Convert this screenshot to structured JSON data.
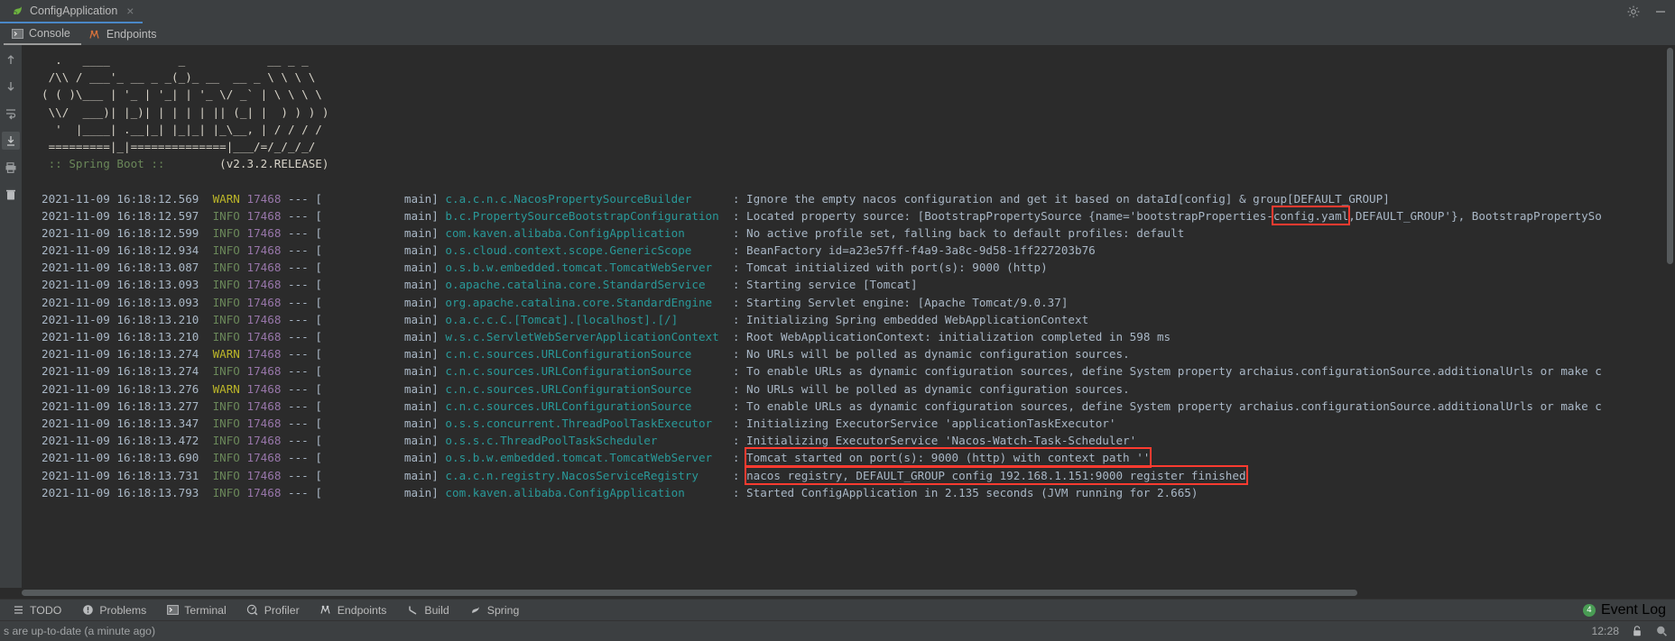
{
  "titlebar": {
    "run_tab_label": "ConfigApplication",
    "close_label": "×",
    "settings_icon": "gear-icon",
    "minimize_icon": "minimize-icon"
  },
  "tool_tabs": [
    {
      "label": "Console",
      "icon": "console-icon",
      "active": true
    },
    {
      "label": "Endpoints",
      "icon": "endpoints-icon",
      "active": false
    }
  ],
  "gutter_buttons": [
    {
      "name": "scroll-up-icon"
    },
    {
      "name": "scroll-down-icon"
    },
    {
      "name": "soft-wrap-icon"
    },
    {
      "name": "scroll-to-end-icon"
    },
    {
      "name": "print-icon"
    },
    {
      "name": "clear-all-icon"
    }
  ],
  "console": {
    "banner_lines": [
      "  .   ____          _            __ _ _",
      " /\\\\ / ___'_ __ _ _(_)_ __  __ _ \\ \\ \\ \\",
      "( ( )\\___ | '_ | '_| | '_ \\/ _` | \\ \\ \\ \\",
      " \\\\/  ___)| |_)| | | | | || (_| |  ) ) ) )",
      "  '  |____| .__|_| |_|_| |_\\__, | / / / /",
      " =========|_|==============|___/=/_/_/_/"
    ],
    "banner_title": " :: Spring Boot :: ",
    "banner_version": "       (v2.3.2.RELEASE)",
    "lines": [
      {
        "ts": "2021-11-09 16:18:12.569",
        "level": "WARN",
        "pid": "17468",
        "sep": "--- [",
        "thread": "            main]",
        "logger": "c.a.c.n.c.NacosPropertySourceBuilder",
        "pad": "     ",
        "msg_pre": ": Ignore the empty nacos configuration and get it based on dataId[config] & group[DEFAULT_GROUP]",
        "highlight": "",
        "msg_post": ""
      },
      {
        "ts": "2021-11-09 16:18:12.597",
        "level": "INFO",
        "pid": "17468",
        "sep": "--- [",
        "thread": "            main]",
        "logger": "b.c.PropertySourceBootstrapConfiguration",
        "pad": " ",
        "msg_pre": ": Located property source: [BootstrapPropertySource {name='bootstrapProperties-",
        "highlight": "config.yaml",
        "msg_post": ",DEFAULT_GROUP'}, BootstrapPropertySo"
      },
      {
        "ts": "2021-11-09 16:18:12.599",
        "level": "INFO",
        "pid": "17468",
        "sep": "--- [",
        "thread": "            main]",
        "logger": "com.kaven.alibaba.ConfigApplication",
        "pad": "      ",
        "msg_pre": ": No active profile set, falling back to default profiles: default",
        "highlight": "",
        "msg_post": ""
      },
      {
        "ts": "2021-11-09 16:18:12.934",
        "level": "INFO",
        "pid": "17468",
        "sep": "--- [",
        "thread": "            main]",
        "logger": "o.s.cloud.context.scope.GenericScope",
        "pad": "     ",
        "msg_pre": ": BeanFactory id=a23e57ff-f4a9-3a8c-9d58-1ff227203b76",
        "highlight": "",
        "msg_post": ""
      },
      {
        "ts": "2021-11-09 16:18:13.087",
        "level": "INFO",
        "pid": "17468",
        "sep": "--- [",
        "thread": "            main]",
        "logger": "o.s.b.w.embedded.tomcat.TomcatWebServer",
        "pad": "  ",
        "msg_pre": ": Tomcat initialized with port(s): 9000 (http)",
        "highlight": "",
        "msg_post": ""
      },
      {
        "ts": "2021-11-09 16:18:13.093",
        "level": "INFO",
        "pid": "17468",
        "sep": "--- [",
        "thread": "            main]",
        "logger": "o.apache.catalina.core.StandardService",
        "pad": "   ",
        "msg_pre": ": Starting service [Tomcat]",
        "highlight": "",
        "msg_post": ""
      },
      {
        "ts": "2021-11-09 16:18:13.093",
        "level": "INFO",
        "pid": "17468",
        "sep": "--- [",
        "thread": "            main]",
        "logger": "org.apache.catalina.core.StandardEngine",
        "pad": "  ",
        "msg_pre": ": Starting Servlet engine: [Apache Tomcat/9.0.37]",
        "highlight": "",
        "msg_post": ""
      },
      {
        "ts": "2021-11-09 16:18:13.210",
        "level": "INFO",
        "pid": "17468",
        "sep": "--- [",
        "thread": "            main]",
        "logger": "o.a.c.c.C.[Tomcat].[localhost].[/]",
        "pad": "       ",
        "msg_pre": ": Initializing Spring embedded WebApplicationContext",
        "highlight": "",
        "msg_post": ""
      },
      {
        "ts": "2021-11-09 16:18:13.210",
        "level": "INFO",
        "pid": "17468",
        "sep": "--- [",
        "thread": "            main]",
        "logger": "w.s.c.ServletWebServerApplicationContext",
        "pad": " ",
        "msg_pre": ": Root WebApplicationContext: initialization completed in 598 ms",
        "highlight": "",
        "msg_post": ""
      },
      {
        "ts": "2021-11-09 16:18:13.274",
        "level": "WARN",
        "pid": "17468",
        "sep": "--- [",
        "thread": "            main]",
        "logger": "c.n.c.sources.URLConfigurationSource",
        "pad": "     ",
        "msg_pre": ": No URLs will be polled as dynamic configuration sources.",
        "highlight": "",
        "msg_post": ""
      },
      {
        "ts": "2021-11-09 16:18:13.274",
        "level": "INFO",
        "pid": "17468",
        "sep": "--- [",
        "thread": "            main]",
        "logger": "c.n.c.sources.URLConfigurationSource",
        "pad": "     ",
        "msg_pre": ": To enable URLs as dynamic configuration sources, define System property archaius.configurationSource.additionalUrls or make c",
        "highlight": "",
        "msg_post": ""
      },
      {
        "ts": "2021-11-09 16:18:13.276",
        "level": "WARN",
        "pid": "17468",
        "sep": "--- [",
        "thread": "            main]",
        "logger": "c.n.c.sources.URLConfigurationSource",
        "pad": "     ",
        "msg_pre": ": No URLs will be polled as dynamic configuration sources.",
        "highlight": "",
        "msg_post": ""
      },
      {
        "ts": "2021-11-09 16:18:13.277",
        "level": "INFO",
        "pid": "17468",
        "sep": "--- [",
        "thread": "            main]",
        "logger": "c.n.c.sources.URLConfigurationSource",
        "pad": "     ",
        "msg_pre": ": To enable URLs as dynamic configuration sources, define System property archaius.configurationSource.additionalUrls or make c",
        "highlight": "",
        "msg_post": ""
      },
      {
        "ts": "2021-11-09 16:18:13.347",
        "level": "INFO",
        "pid": "17468",
        "sep": "--- [",
        "thread": "            main]",
        "logger": "o.s.s.concurrent.ThreadPoolTaskExecutor",
        "pad": "  ",
        "msg_pre": ": Initializing ExecutorService 'applicationTaskExecutor'",
        "highlight": "",
        "msg_post": ""
      },
      {
        "ts": "2021-11-09 16:18:13.472",
        "level": "INFO",
        "pid": "17468",
        "sep": "--- [",
        "thread": "            main]",
        "logger": "o.s.s.c.ThreadPoolTaskScheduler",
        "pad": "          ",
        "msg_pre": ": Initializing ExecutorService 'Nacos-Watch-Task-Scheduler'",
        "highlight": "",
        "msg_post": ""
      },
      {
        "ts": "2021-11-09 16:18:13.690",
        "level": "INFO",
        "pid": "17468",
        "sep": "--- [",
        "thread": "            main]",
        "logger": "o.s.b.w.embedded.tomcat.TomcatWebServer",
        "pad": "  ",
        "msg_pre": ": ",
        "highlight": "Tomcat started on port(s): 9000 (http) with context path ''",
        "msg_post": ""
      },
      {
        "ts": "2021-11-09 16:18:13.731",
        "level": "INFO",
        "pid": "17468",
        "sep": "--- [",
        "thread": "            main]",
        "logger": "c.a.c.n.registry.NacosServiceRegistry",
        "pad": "    ",
        "msg_pre": ": ",
        "highlight": "nacos registry, DEFAULT_GROUP config 192.168.1.151:9000 register finished",
        "msg_post": ""
      },
      {
        "ts": "2021-11-09 16:18:13.793",
        "level": "INFO",
        "pid": "17468",
        "sep": "--- [",
        "thread": "            main]",
        "logger": "com.kaven.alibaba.ConfigApplication",
        "pad": "      ",
        "msg_pre": ": Started ConfigApplication in 2.135 seconds (JVM running for 2.665)",
        "highlight": "",
        "msg_post": ""
      }
    ]
  },
  "bottom_bar": {
    "items": [
      {
        "label": "TODO",
        "icon": "todo-icon"
      },
      {
        "label": "Problems",
        "icon": "problems-icon"
      },
      {
        "label": "Terminal",
        "icon": "terminal-icon"
      },
      {
        "label": "Profiler",
        "icon": "profiler-icon"
      },
      {
        "label": "Endpoints",
        "icon": "endpoints-icon"
      },
      {
        "label": "Build",
        "icon": "build-icon"
      },
      {
        "label": "Spring",
        "icon": "spring-icon"
      }
    ],
    "event_log_label": "Event Log",
    "event_log_count": "4"
  },
  "status_bar": {
    "message": "s are up-to-date (a minute ago)",
    "time": "12:28",
    "lock_icon": "lock-icon",
    "inspector_icon": "inspector-icon"
  },
  "colors": {
    "accent_blue": "#4a88c7",
    "highlight_red": "#ff3b30",
    "info_green": "#6a8759",
    "warn_yellow": "#bbb529",
    "pid_purple": "#9876aa",
    "logger_teal": "#299999",
    "console_bg": "#2b2b2b",
    "chrome_bg": "#3c3f41",
    "badge_green": "#499c54"
  }
}
